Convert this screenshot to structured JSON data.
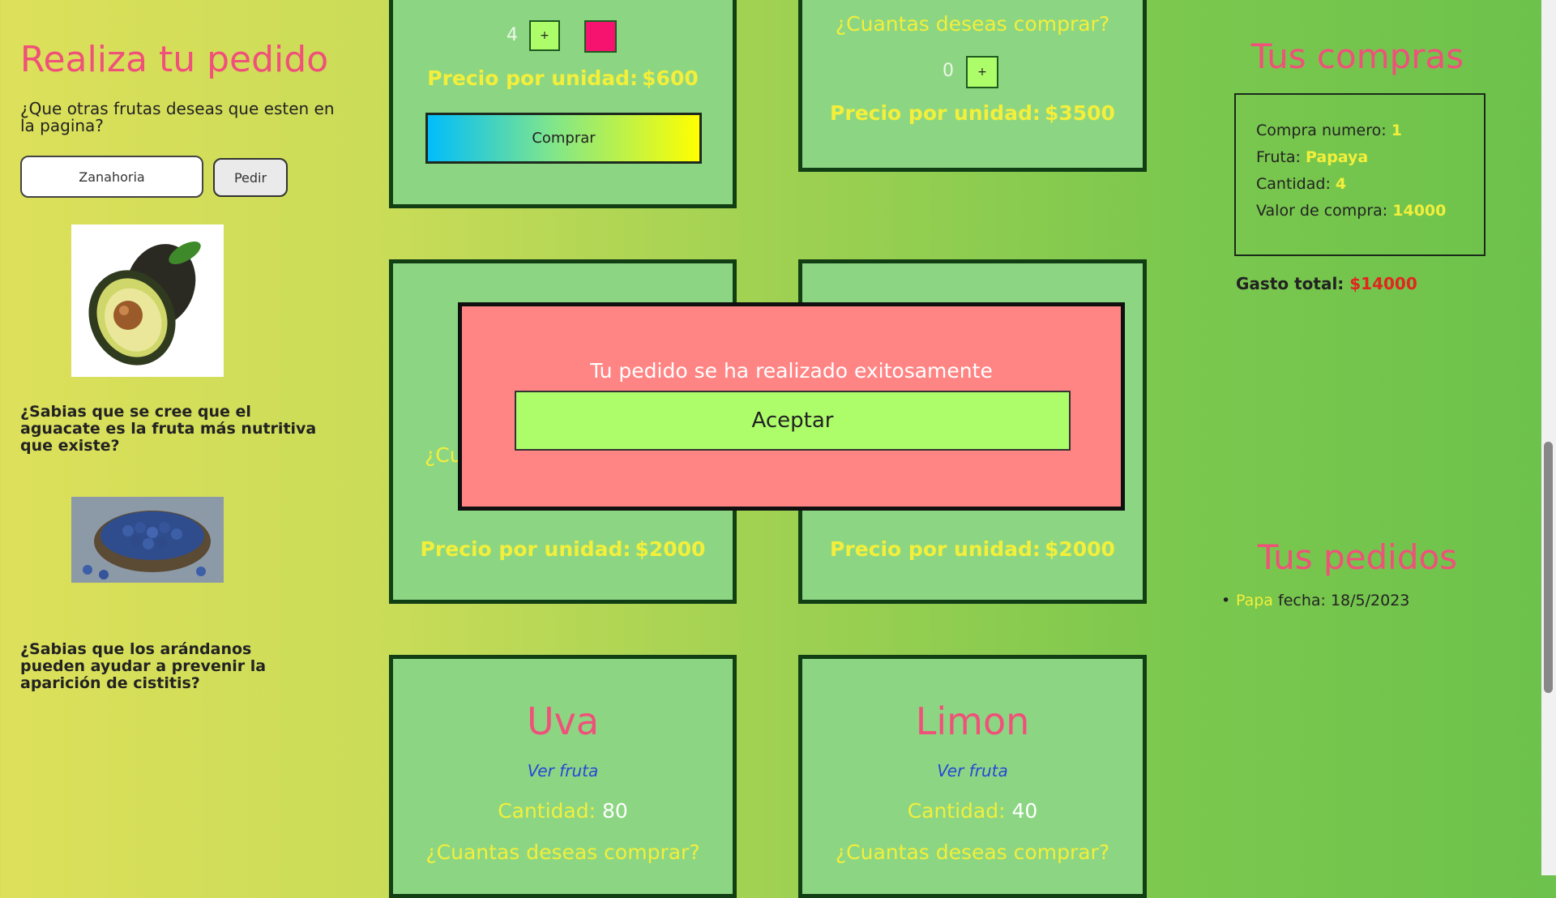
{
  "left": {
    "title": "Realiza tu pedido",
    "question": "¿Que otras frutas deseas que esten en la pagina?",
    "input_value": "Zanahoria",
    "request_button": "Pedir",
    "fact1": "¿Sabias que se cree que el aguacate es la fruta más nutritiva que existe?",
    "fact2": "¿Sabias que los arándanos pueden ayudar a prevenir la aparición de cistitis?"
  },
  "cards": {
    "top_left": {
      "qty": "4",
      "plus": "+",
      "price_label": "Precio por unidad:",
      "price": "$600",
      "buy": "Comprar"
    },
    "top_right": {
      "ask": "¿Cuantas deseas comprar?",
      "qty": "0",
      "plus": "+",
      "price_label": "Precio por unidad:",
      "price": "$3500"
    },
    "mid_left": {
      "ask_partial": "¿Cu",
      "price_label": "Precio por unidad:",
      "price": "$2000"
    },
    "mid_right": {
      "price_label": "Precio por unidad:",
      "price": "$2000"
    },
    "bottom_left": {
      "title": "Uva",
      "link": "Ver fruta",
      "qty_label": "Cantidad:",
      "qty": "80",
      "ask": "¿Cuantas deseas comprar?"
    },
    "bottom_right": {
      "title": "Limon",
      "link": "Ver fruta",
      "qty_label": "Cantidad:",
      "qty": "40",
      "ask": "¿Cuantas deseas comprar?"
    }
  },
  "right": {
    "purchases_title": "Tus compras",
    "purchase": {
      "number_label": "Compra numero:",
      "number": "1",
      "fruit_label": "Fruta:",
      "fruit": "Papaya",
      "qty_label": "Cantidad:",
      "qty": "4",
      "value_label": "Valor de compra:",
      "value": "14000"
    },
    "total_label": "Gasto total:",
    "total": "$14000",
    "orders_title": "Tus pedidos",
    "orders": [
      {
        "item": "Papa",
        "date_label": "fecha:",
        "date": "18/5/2023"
      }
    ]
  },
  "modal": {
    "message": "Tu pedido se ha realizado exitosamente",
    "accept": "Aceptar"
  },
  "colors": {
    "accent_pink": "#f0507a",
    "card_green": "#8cd683",
    "modal_red": "#ff8585",
    "button_lime": "#adfd6a"
  },
  "icons": {
    "plus": "plus-icon"
  }
}
